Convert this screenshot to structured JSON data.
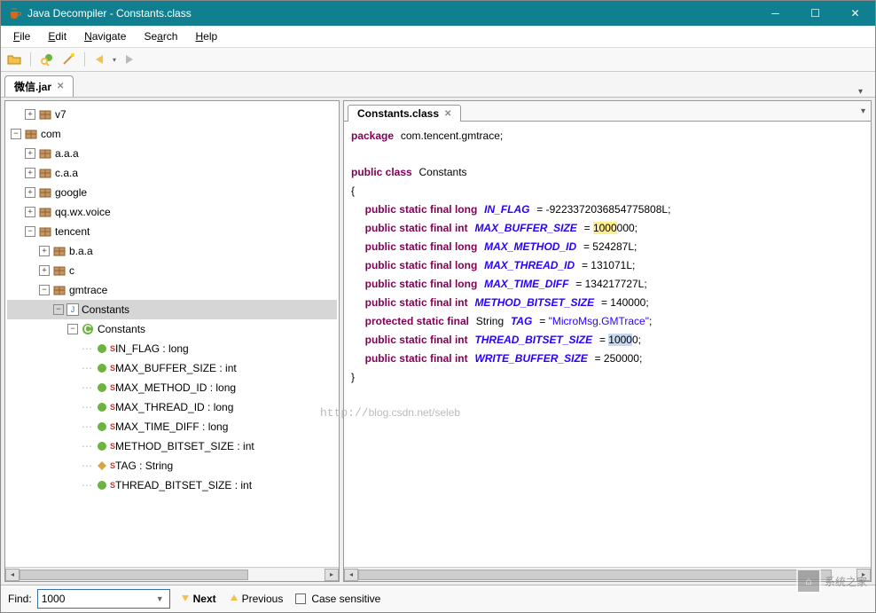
{
  "title": "Java Decompiler - Constants.class",
  "menu": {
    "file": "File",
    "edit": "Edit",
    "navigate": "Navigate",
    "search": "Search",
    "help": "Help"
  },
  "file_tab": "微信.jar",
  "code_tab": "Constants.class",
  "tree": {
    "v7": "v7",
    "com": "com",
    "aaa": "a.a.a",
    "caa": "c.a.a",
    "google": "google",
    "qq": "qq.wx.voice",
    "tencent": "tencent",
    "baa": "b.a.a",
    "c": "c",
    "gmtrace": "gmtrace",
    "constants_file": "Constants",
    "constants_class": "Constants",
    "fields": [
      {
        "name": "IN_FLAG : long"
      },
      {
        "name": "MAX_BUFFER_SIZE : int"
      },
      {
        "name": "MAX_METHOD_ID : long"
      },
      {
        "name": "MAX_THREAD_ID : long"
      },
      {
        "name": "MAX_TIME_DIFF : long"
      },
      {
        "name": "METHOD_BITSET_SIZE : int"
      },
      {
        "name": "TAG : String"
      },
      {
        "name": "THREAD_BITSET_SIZE : int"
      }
    ]
  },
  "code": {
    "pkg": "package",
    "pkgname": "com.tencent.gmtrace;",
    "pub": "public",
    "cls": "class",
    "name": "Constants",
    "stat": "static",
    "fin": "final",
    "prot": "protected",
    "t_long": "long",
    "t_int": "int",
    "t_str": "String",
    "lines": [
      {
        "f": "IN_FLAG",
        "v": "-9223372036854775808L"
      },
      {
        "f": "MAX_BUFFER_SIZE",
        "v_pre": "",
        "v_hl": "1000",
        "v_post": "000"
      },
      {
        "f": "MAX_METHOD_ID",
        "v": "524287L"
      },
      {
        "f": "MAX_THREAD_ID",
        "v": "131071L"
      },
      {
        "f": "MAX_TIME_DIFF",
        "v": "134217727L"
      },
      {
        "f": "METHOD_BITSET_SIZE",
        "v": "140000"
      },
      {
        "tag": true,
        "f": "TAG",
        "v": "\"MicroMsg.GMTrace\""
      },
      {
        "f": "THREAD_BITSET_SIZE",
        "v_pre": "",
        "v_hl2": "1000",
        "v_post": "0"
      },
      {
        "f": "WRITE_BUFFER_SIZE",
        "v": "250000"
      }
    ]
  },
  "find": {
    "label": "Find:",
    "value": "1000",
    "next": "Next",
    "prev": "Previous",
    "cs": "Case sensitive"
  },
  "watermark_url": "blog.csdn.net/seleb",
  "watermark2": "系统之家"
}
